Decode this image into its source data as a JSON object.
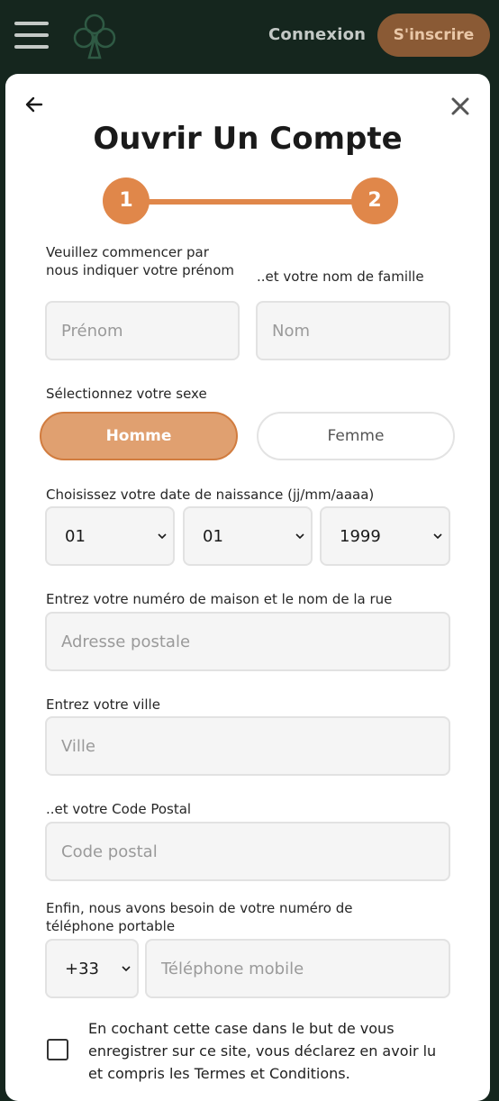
{
  "header": {
    "login_label": "Connexion",
    "signup_label": "S'inscrire",
    "brand_color": "#15261e",
    "accent_color": "#8a5a35"
  },
  "modal": {
    "title": "Ouvrir Un Compte",
    "steps": [
      "1",
      "2"
    ],
    "accent_color": "#e0874a"
  },
  "form": {
    "first_name_label": "Veuillez commencer par nous indiquer votre prénom",
    "first_name_placeholder": "Prénom",
    "last_name_label": "..et votre nom de famille",
    "last_name_placeholder": "Nom",
    "gender_label": "Sélectionnez votre sexe",
    "gender_options": [
      "Homme",
      "Femme"
    ],
    "gender_selected": "Homme",
    "dob_label": "Choisissez votre date de naissance (jj/mm/aaaa)",
    "dob_day": "01",
    "dob_month": "01",
    "dob_year": "1999",
    "address_label": "Entrez votre numéro de maison et le nom de la rue",
    "address_placeholder": "Adresse postale",
    "city_label": "Entrez votre ville",
    "city_placeholder": "Ville",
    "postcode_label": "..et votre Code Postal",
    "postcode_placeholder": "Code postal",
    "phone_label": "Enfin, nous avons besoin de votre numéro de téléphone portable",
    "phone_prefix": "+33",
    "phone_placeholder": "Téléphone mobile",
    "consent_text": "En cochant cette case dans le but de vous enregistrer sur ce site, vous déclarez en avoir lu et compris les Termes et Conditions."
  },
  "icons": {
    "menu": "hamburger-icon",
    "logo": "club-logo-icon",
    "back": "arrow-left-icon",
    "close": "close-icon",
    "dropdown": "chevron-down-icon"
  }
}
